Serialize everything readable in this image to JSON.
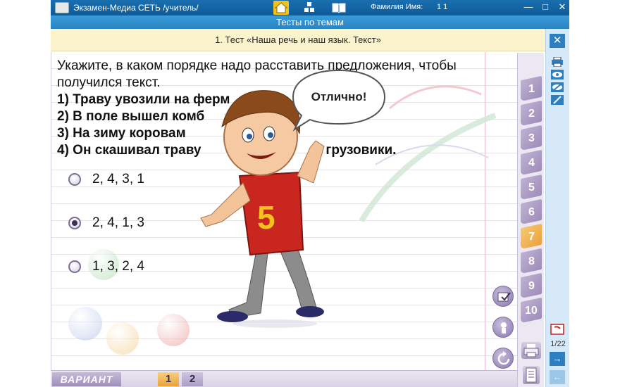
{
  "window": {
    "app_title": "Экзамен-Медиа СЕТЬ /учитель/",
    "user_label": "Фамилия Имя:",
    "user_name": "1 1",
    "minimize": "—",
    "maximize": "□",
    "close": "✕"
  },
  "section_title": "Тесты по темам",
  "test_title": "1. Тест «Наша речь и наш язык. Текст»",
  "question": {
    "prompt": "Укажите, в каком порядке надо расставить предложения, чтобы получился текст.",
    "statements": [
      "1) Траву увозили на ферм",
      "2) В поле вышел комб",
      "3) На зиму коровам",
      "4) Он скашивал траву",
      "в грузовики."
    ]
  },
  "answers": [
    {
      "label": "2, 4, 3, 1",
      "checked": false
    },
    {
      "label": "2, 4, 1, 3",
      "checked": true
    },
    {
      "label": "1, 3, 2, 4",
      "checked": false
    }
  ],
  "feedback": "Отлично!",
  "mascot_number": "5",
  "question_tabs": [
    {
      "label": "1",
      "active": false
    },
    {
      "label": "2",
      "active": false
    },
    {
      "label": "3",
      "active": false
    },
    {
      "label": "4",
      "active": false
    },
    {
      "label": "5",
      "active": false
    },
    {
      "label": "6",
      "active": false
    },
    {
      "label": "7",
      "active": true
    },
    {
      "label": "8",
      "active": false
    },
    {
      "label": "9",
      "active": false
    },
    {
      "label": "10",
      "active": false
    }
  ],
  "side_panel": {
    "close": "✕",
    "page_counter": "1/22",
    "next": "→",
    "prev": "←"
  },
  "bottom": {
    "variant_label": "ВАРИАНТ",
    "variants": [
      "1",
      "2"
    ],
    "active_variant": "1"
  },
  "colors": {
    "titlebar": "#1a6fb0",
    "section_bar": "#2a84c2",
    "test_bar": "#fbf3cc",
    "tab_purple": "#9d8cb8",
    "tab_active": "#eaa23c"
  }
}
